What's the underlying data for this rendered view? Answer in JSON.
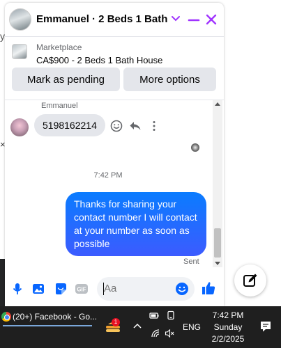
{
  "chat": {
    "header_title": "Emmanuel · 2 Beds 1 Bath ...",
    "marketplace_label": "Marketplace",
    "listing_title": "CA$900 - 2 Beds 1 Bath House",
    "mark_pending_label": "Mark as pending",
    "more_options_label": "More options"
  },
  "messages": {
    "sender_name": "Emmanuel",
    "incoming_text": "5198162214",
    "timestamp": "7:42 PM",
    "outgoing_text": "Thanks for sharing your contact number I will contact at your number as soon as possible",
    "status": "Sent"
  },
  "composer": {
    "placeholder": "Aa"
  },
  "taskbar": {
    "task_label": "(20+) Facebook - Go...",
    "app_badge": "1",
    "language": "ENG",
    "time": "7:42 PM",
    "day": "Sunday",
    "date": "2/2/2025"
  },
  "colors": {
    "accent": "#a033ff",
    "messenger_blue": "#0a7cff",
    "bubble_gray": "#e4e6eb",
    "taskbar": "#1f1f1f"
  }
}
